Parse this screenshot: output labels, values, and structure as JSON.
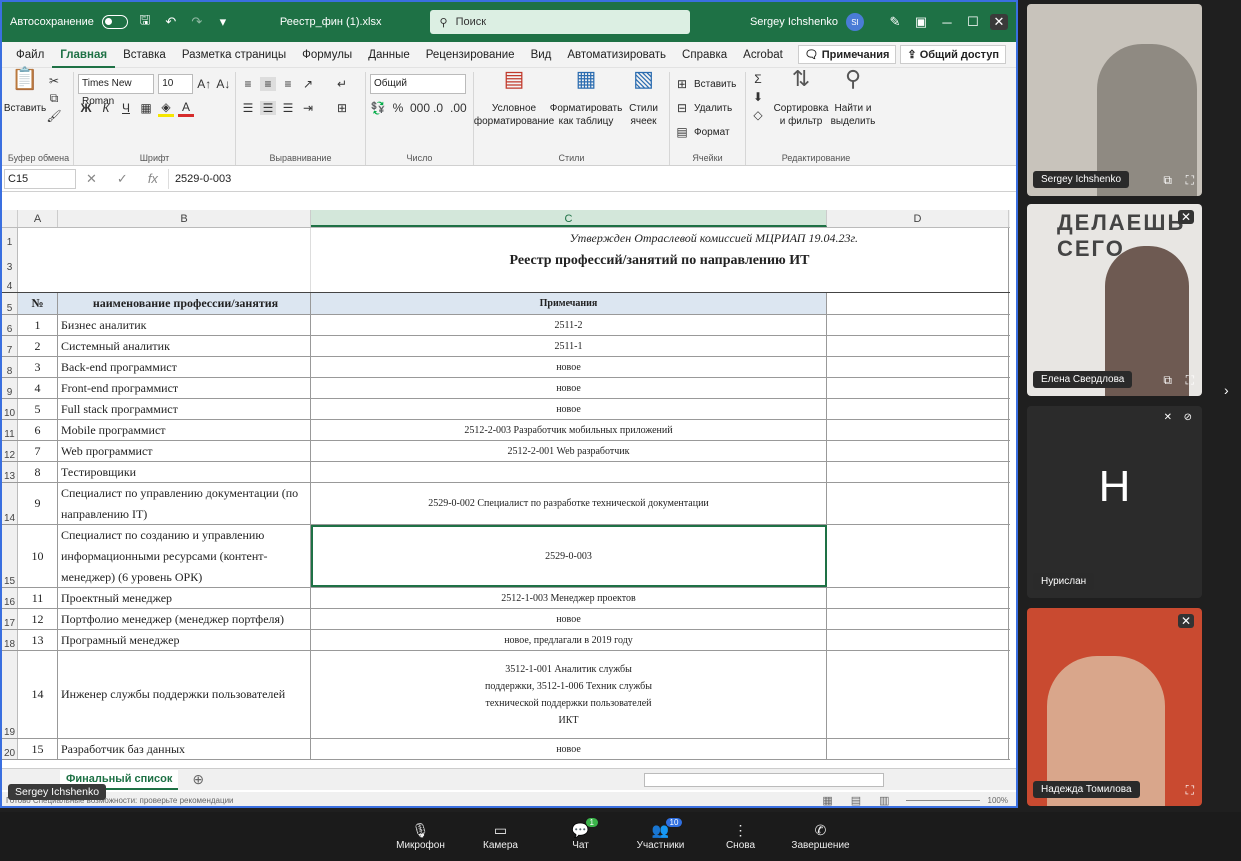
{
  "excel": {
    "autosave": "Автосохранение",
    "filename": "Реестр_фин (1).xlsx",
    "search": "Поиск",
    "user": "Sergey Ichshenko",
    "initials": "SI",
    "menu": [
      "Файл",
      "Главная",
      "Вставка",
      "Разметка страницы",
      "Формулы",
      "Данные",
      "Рецензирование",
      "Вид",
      "Автоматизировать",
      "Справка",
      "Acrobat"
    ],
    "comments_btn": "Примечания",
    "share_btn": "Общий доступ",
    "ribbon": {
      "paste": "Вставить",
      "clipboard": "Буфер обмена",
      "font_name": "Times New Roman",
      "font_size": "10",
      "font": "Шрифт",
      "alignment": "Выравнивание",
      "number_format": "Общий",
      "number": "Число",
      "cond_format": "Условное форматирование",
      "format_table": "Форматировать как таблицу",
      "cell_styles": "Стили ячеек",
      "styles": "Стили",
      "insert": "Вставить",
      "delete": "Удалить",
      "format": "Формат",
      "cells": "Ячейки",
      "sort": "Сортировка и фильтр",
      "find": "Найти и выделить",
      "editing": "Редактирование"
    },
    "namebox": "C15",
    "formula": "2529-0-003",
    "columns": [
      "A",
      "B",
      "C",
      "D"
    ],
    "rows": [
      {
        "n": "1",
        "a": "",
        "b": "",
        "c": "Утвержден Отраслевой комиссией МЦРИАП 19.04.23г.",
        "type": "approved"
      },
      {
        "n": "3",
        "a": "",
        "b": "",
        "c": "Реестр профессий/занятий по направлению ИТ",
        "type": "title"
      },
      {
        "n": "4",
        "a": "",
        "b": "",
        "c": "",
        "type": "blank"
      },
      {
        "n": "5",
        "a": "№",
        "b": "наименование профессии/занятия",
        "c": "Примечания",
        "type": "hdr"
      },
      {
        "n": "6",
        "a": "1",
        "b": "Бизнес аналитик",
        "c": "2511-2"
      },
      {
        "n": "7",
        "a": "2",
        "b": "Системный аналитик",
        "c": "2511-1"
      },
      {
        "n": "8",
        "a": "3",
        "b": "Back-end программист",
        "c": "новое"
      },
      {
        "n": "9",
        "a": "4",
        "b": "Front-end программист",
        "c": "новое"
      },
      {
        "n": "10",
        "a": "5",
        "b": "Full stack программист",
        "c": "новое"
      },
      {
        "n": "11",
        "a": "6",
        "b": "Mobile программист",
        "c": "2512-2-003 Разработчик мобильных приложений"
      },
      {
        "n": "12",
        "a": "7",
        "b": "Web программист",
        "c": "2512-2-001 Web разработчик"
      },
      {
        "n": "13",
        "a": "8",
        "b": "Тестировщики",
        "c": ""
      },
      {
        "n": "14",
        "a": "9",
        "b": "Специалист по управлению документации (по направлению IT)",
        "c": "2529-0-002 Специалист по разработке технической документации",
        "type": "h2"
      },
      {
        "n": "15",
        "a": "10",
        "b": "Специалист по созданию и управлению информационными ресурсами (контент-менеджер) (6 уровень ОРК)",
        "c": "2529-0-003",
        "type": "h3"
      },
      {
        "n": "16",
        "a": "11",
        "b": "Проектный менеджер",
        "c": "2512-1-003 Менеджер проектов"
      },
      {
        "n": "17",
        "a": "12",
        "b": "Портфолио менеджер (менеджер портфеля)",
        "c": "новое"
      },
      {
        "n": "18",
        "a": "13",
        "b": "Програмный менеджер",
        "c": "новое, предлагали в 2019 году"
      },
      {
        "n": "19",
        "a": "14",
        "b": "Инженер службы поддержки пользователей",
        "c": "3512-1-001 Аналитик службы поддержки, 3512-1-006 Техник службы технической поддержки пользователей ИКТ",
        "type": "h4"
      },
      {
        "n": "20",
        "a": "15",
        "b": "Разработчик баз данных",
        "c": "новое"
      }
    ],
    "sheet_tab": "Финальный список",
    "status": "Готово   Специальные возможности: проверьте рекомендации",
    "zoom": "100%"
  },
  "meeting": {
    "presenter_tag": "Sergey Ichshenko",
    "tiles": [
      {
        "name": "Sergey Ichshenko"
      },
      {
        "name": "Елена Свердлова",
        "bg_text": "ДЕЛАЕШЬ СЕГО"
      },
      {
        "name": "Нурислан",
        "initial": "Н"
      },
      {
        "name": "Надежда Томилова"
      }
    ],
    "controls": [
      {
        "label": "Микрофон",
        "icon": "mic-off-icon",
        "glyph": "🎙"
      },
      {
        "label": "Камера",
        "icon": "camera-icon",
        "glyph": "▭"
      },
      {
        "label": "Чат",
        "icon": "chat-icon",
        "glyph": "💬",
        "badge": "1"
      },
      {
        "label": "Участники",
        "icon": "participants-icon",
        "glyph": "👥",
        "badge": "10"
      },
      {
        "label": "Снова",
        "icon": "more-icon",
        "glyph": "⋮"
      },
      {
        "label": "Завершение",
        "icon": "end-call-icon",
        "glyph": "✆"
      }
    ]
  }
}
